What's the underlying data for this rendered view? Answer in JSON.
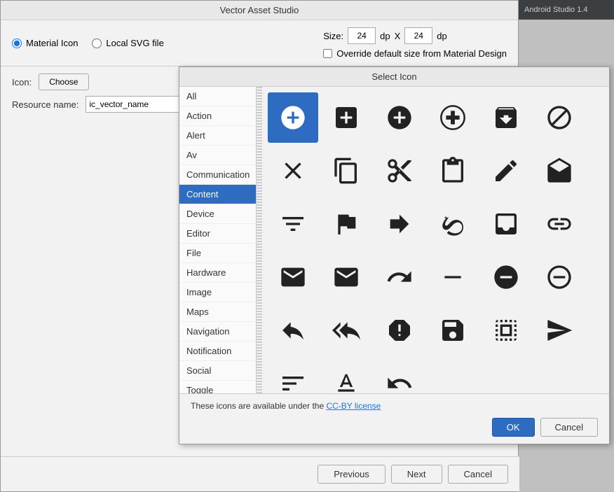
{
  "app": {
    "title": "Vector Asset Studio",
    "android_studio_label": "Android Studio 1.4"
  },
  "top_panel": {
    "material_icon_label": "Material Icon",
    "local_svg_label": "Local SVG file",
    "size_label": "Size:",
    "size_w": "24",
    "size_h": "24",
    "dp_label": "dp",
    "x_label": "X",
    "override_label": "Override default size from Material Design"
  },
  "left_panel": {
    "icon_label": "Icon:",
    "choose_label": "Choose",
    "resource_label": "Resource name:",
    "resource_value": "ic_vector_name"
  },
  "select_icon_dialog": {
    "title": "Select Icon",
    "categories": [
      "All",
      "Action",
      "Alert",
      "Av",
      "Communication",
      "Content",
      "Device",
      "Editor",
      "File",
      "Hardware",
      "Image",
      "Maps",
      "Navigation",
      "Notification",
      "Social",
      "Toggle"
    ],
    "selected_category": "Content",
    "license_text": "These icons are available under the",
    "license_link": "CC-BY license",
    "ok_label": "OK",
    "cancel_label": "Cancel"
  },
  "bottom_nav": {
    "previous_label": "Previous",
    "next_label": "Next",
    "cancel_label": "Cancel"
  }
}
